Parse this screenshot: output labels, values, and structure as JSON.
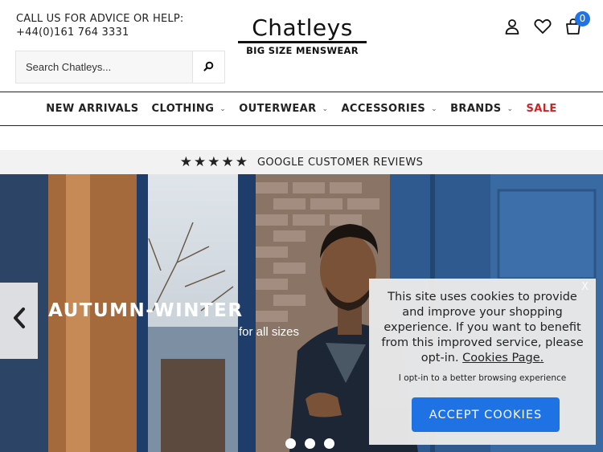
{
  "header": {
    "contact_heading": "CALL US FOR ADVICE OR HELP:",
    "phone": "+44(0)161 764 3331",
    "search_placeholder": "Search Chatleys...",
    "logo_main": "Chatleys",
    "logo_sub": "BIG SIZE MENSWEAR",
    "cart_count": "0",
    "icons": [
      "account-icon",
      "wishlist-heart-icon",
      "cart-bag-icon",
      "search-icon"
    ]
  },
  "nav": {
    "items": [
      {
        "label": "NEW ARRIVALS",
        "has_dropdown": false
      },
      {
        "label": "CLOTHING",
        "has_dropdown": true
      },
      {
        "label": "OUTERWEAR",
        "has_dropdown": true
      },
      {
        "label": "ACCESSORIES",
        "has_dropdown": true
      },
      {
        "label": "BRANDS",
        "has_dropdown": true
      },
      {
        "label": "SALE",
        "has_dropdown": false
      }
    ],
    "sale_color": "#c62828"
  },
  "reviews": {
    "stars": "★★★★★",
    "label": "GOOGLE CUSTOMER REVIEWS"
  },
  "hero": {
    "title": "AUTUMN-WINTER",
    "subtitle": "for all sizes",
    "slide_count": 3
  },
  "cookie": {
    "close": "X",
    "message": "This site uses cookies to provide and improve your shopping experience. If you want to benefit from this improved service, please opt-in.",
    "link": "Cookies Page.",
    "optin_text": "I opt-in to a better browsing experience",
    "accept_label": "ACCEPT COOKIES",
    "accent_color": "#1f73e6"
  }
}
